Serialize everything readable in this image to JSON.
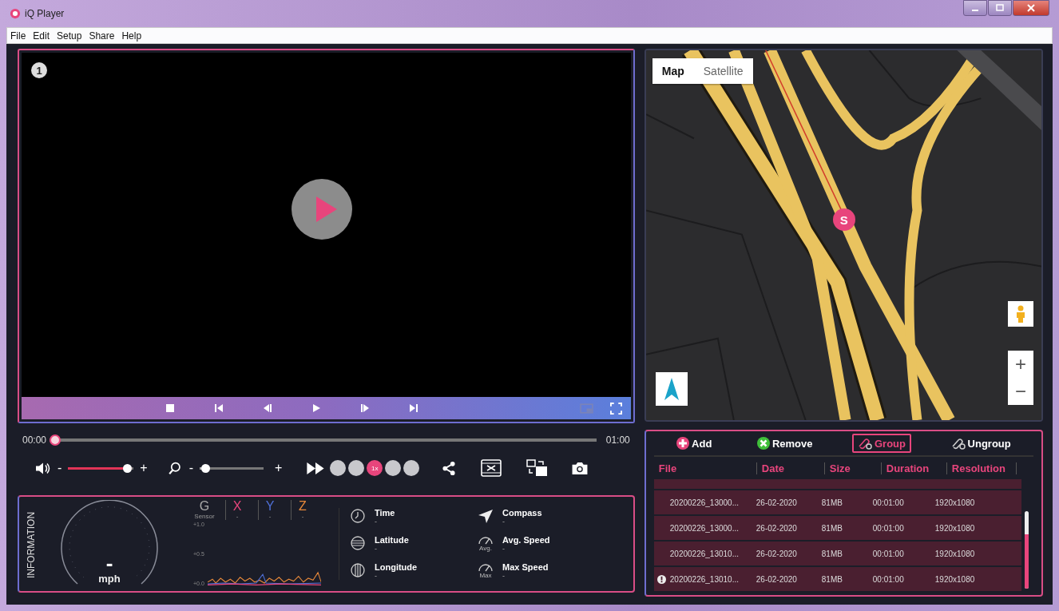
{
  "window": {
    "title": "iQ Player"
  },
  "menu": [
    "File",
    "Edit",
    "Setup",
    "Share",
    "Help"
  ],
  "video": {
    "channel": "1"
  },
  "timeline": {
    "current": "00:00",
    "total": "01:00",
    "level": 0
  },
  "volume": {
    "minus": "-",
    "plus": "+",
    "level": 0.97
  },
  "zoom": {
    "minus": "-",
    "plus": "+",
    "level": 0.03
  },
  "speeds": [
    {
      "selected": false
    },
    {
      "selected": false
    },
    {
      "label": "1x",
      "selected": true
    },
    {
      "selected": false
    },
    {
      "selected": false
    }
  ],
  "map": {
    "tabs": [
      {
        "label": "Map",
        "selected": true
      },
      {
        "label": "Satellite",
        "selected": false
      }
    ],
    "marker": "S",
    "zoom_in": "+",
    "zoom_out": "−"
  },
  "files": {
    "actions": [
      {
        "kind": "add",
        "label": "Add",
        "selected": false
      },
      {
        "kind": "remove",
        "label": "Remove",
        "selected": false
      },
      {
        "kind": "group",
        "label": "Group",
        "selected": true
      },
      {
        "kind": "ungroup",
        "label": "Ungroup",
        "selected": false
      }
    ],
    "columns": [
      "File",
      "Date",
      "Size",
      "Duration",
      "Resolution"
    ],
    "rows": [
      {
        "flagged": false,
        "cells": [
          "20200226_13000...",
          "26-02-2020",
          "81MB",
          "00:01:00",
          "1920x1080"
        ]
      },
      {
        "flagged": false,
        "cells": [
          "20200226_13000...",
          "26-02-2020",
          "81MB",
          "00:01:00",
          "1920x1080"
        ]
      },
      {
        "flagged": false,
        "cells": [
          "20200226_13010...",
          "26-02-2020",
          "81MB",
          "00:01:00",
          "1920x1080"
        ]
      },
      {
        "flagged": true,
        "cells": [
          "20200226_13010...",
          "26-02-2020",
          "81MB",
          "00:01:00",
          "1920x1080"
        ]
      }
    ]
  },
  "information": {
    "title": "INFORMATION",
    "speed": "-",
    "unit": "mph",
    "gsensor": {
      "label": "G",
      "sublabel": "Sensor",
      "ticks": [
        "+1.0",
        "+0.5",
        "+0.0"
      ],
      "axes": [
        {
          "name": "X",
          "value": "-",
          "color": "#e8457c"
        },
        {
          "name": "Y",
          "value": "-",
          "color": "#4f6fd6"
        },
        {
          "name": "Z",
          "value": "-",
          "color": "#e8893a"
        }
      ]
    },
    "fields": [
      {
        "kind": "time",
        "label": "Time",
        "value": "-"
      },
      {
        "kind": "compass",
        "label": "Compass",
        "value": "-"
      },
      {
        "kind": "latitude",
        "label": "Latitude",
        "value": "-"
      },
      {
        "kind": "avg",
        "label": "Avg. Speed",
        "value": "-",
        "icon_text": "Avg."
      },
      {
        "kind": "longitude",
        "label": "Longitude",
        "value": "-"
      },
      {
        "kind": "max",
        "label": "Max Speed",
        "value": "-",
        "icon_text": "Max"
      }
    ]
  }
}
